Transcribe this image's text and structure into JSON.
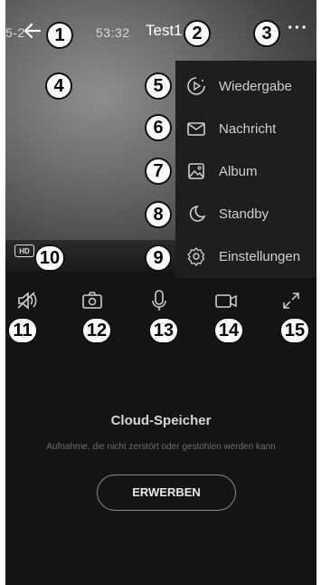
{
  "header": {
    "timestamp": "5-2",
    "timestamp_tail": "53:32",
    "title": "Test1",
    "more_label": "···"
  },
  "menu": {
    "items": [
      {
        "label": "Wiedergabe",
        "icon": "playback-icon"
      },
      {
        "label": "Nachricht",
        "icon": "mail-icon"
      },
      {
        "label": "Album",
        "icon": "image-icon"
      },
      {
        "label": "Standby",
        "icon": "moon-icon"
      },
      {
        "label": "Einstellungen",
        "icon": "gear-icon"
      }
    ]
  },
  "video": {
    "hd_label": "HD"
  },
  "toolbar": {
    "icons": [
      "mute-icon",
      "snapshot-icon",
      "microphone-icon",
      "record-icon",
      "fullscreen-icon"
    ]
  },
  "cloud": {
    "title": "Cloud-Speicher",
    "subtitle": "Aufnahme, die nicht zerstört oder gestohlen werden kann",
    "button": "ERWERBEN"
  },
  "markers": [
    "1",
    "2",
    "3",
    "4",
    "5",
    "6",
    "7",
    "8",
    "9",
    "10",
    "11",
    "12",
    "13",
    "14",
    "15"
  ],
  "colors": {
    "background": "#141414",
    "menu": "#1e1e1e",
    "text": "#cfcfcf"
  }
}
